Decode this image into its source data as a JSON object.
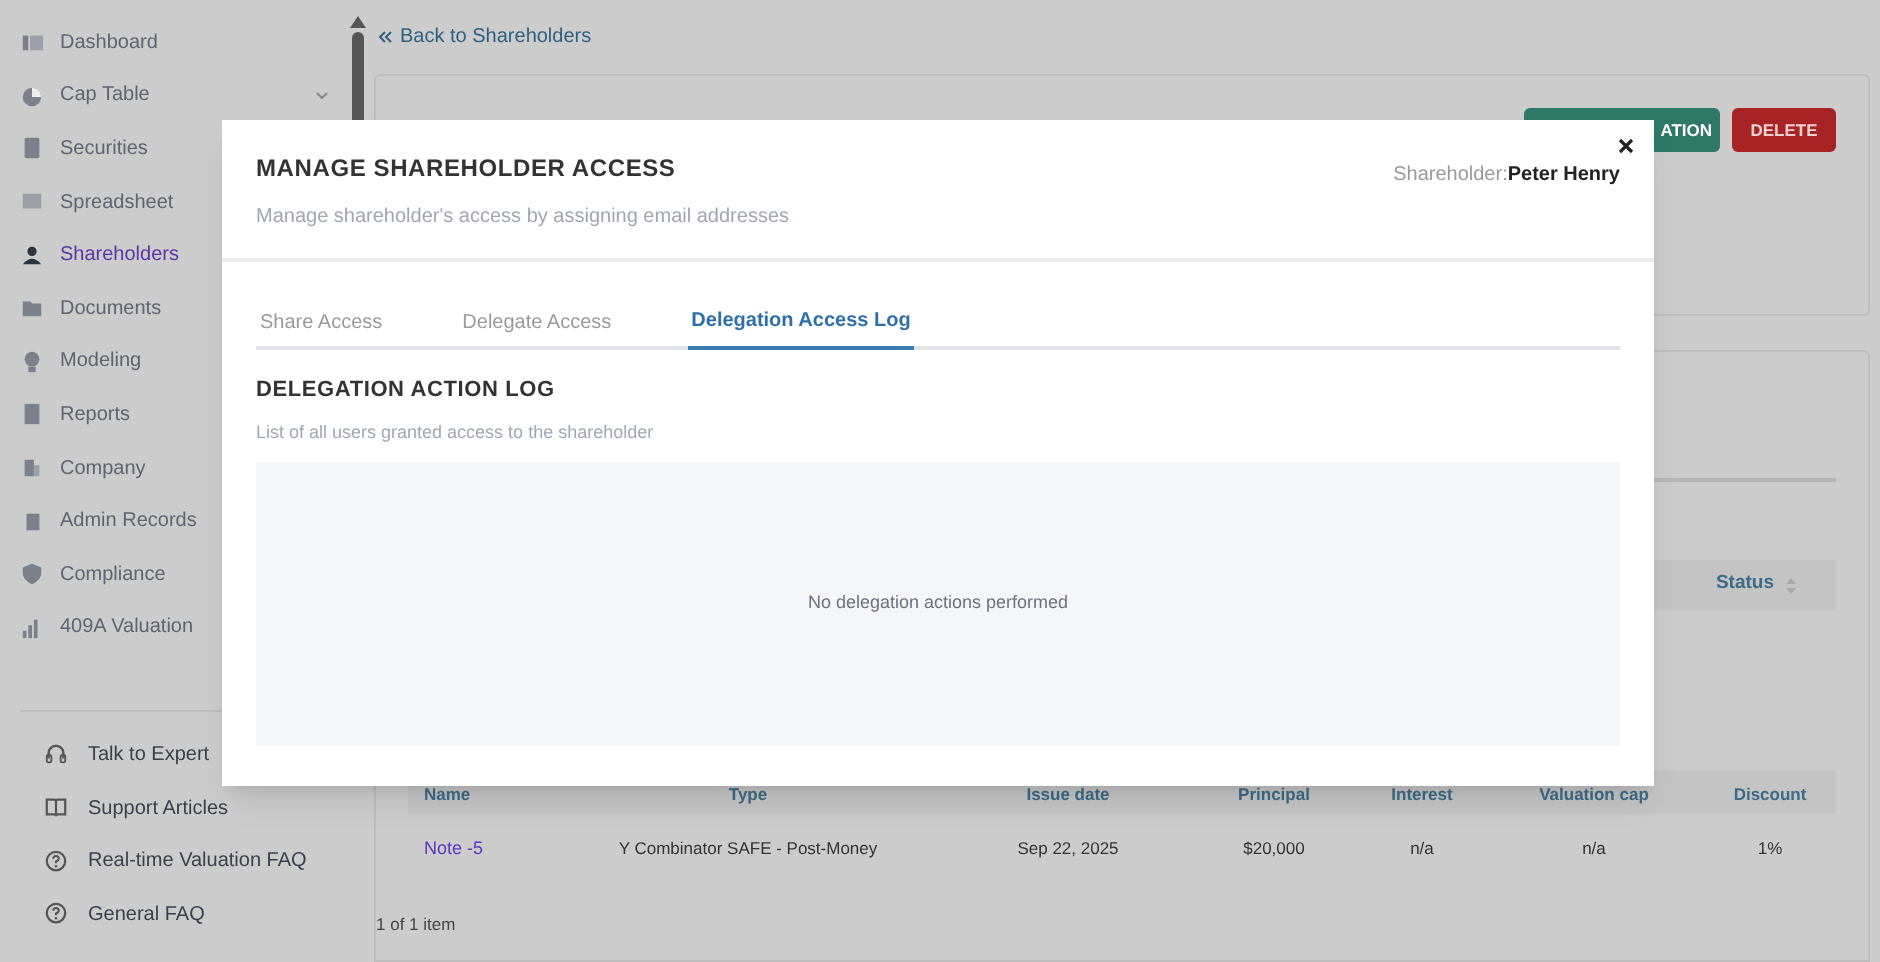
{
  "sidebar": {
    "items": [
      {
        "label": "Dashboard",
        "selected": false,
        "expandable": false
      },
      {
        "label": "Cap Table",
        "selected": false,
        "expandable": true
      },
      {
        "label": "Securities",
        "selected": false,
        "expandable": false
      },
      {
        "label": "Spreadsheet",
        "selected": false,
        "expandable": false
      },
      {
        "label": "Shareholders",
        "selected": true,
        "expandable": false
      },
      {
        "label": "Documents",
        "selected": false,
        "expandable": false
      },
      {
        "label": "Modeling",
        "selected": false,
        "expandable": false
      },
      {
        "label": "Reports",
        "selected": false,
        "expandable": false
      },
      {
        "label": "Company",
        "selected": false,
        "expandable": false
      },
      {
        "label": "Admin Records",
        "selected": false,
        "expandable": false
      },
      {
        "label": "Compliance",
        "selected": false,
        "expandable": false
      },
      {
        "label": "409A Valuation",
        "selected": false,
        "expandable": false
      }
    ],
    "help_links": [
      "Talk to Expert",
      "Support Articles",
      "Real-time Valuation FAQ",
      "General FAQ"
    ]
  },
  "back_link": "Back to Shareholders",
  "actions": [
    {
      "label": "ATION",
      "kind": "primary"
    },
    {
      "label": "DELETE",
      "kind": "danger"
    }
  ],
  "transactions_table": {
    "columns": [
      "Status"
    ]
  },
  "notes_table": {
    "columns": [
      "Name",
      "Type",
      "Issue date",
      "Principal",
      "Interest",
      "Valuation cap",
      "Discount"
    ],
    "rows": [
      [
        "Note -5",
        "Y Combinator SAFE - Post-Money",
        "Sep 22, 2025",
        "$20,000",
        "n/a",
        "n/a",
        "1%"
      ]
    ],
    "pagination": "1 of 1 item"
  },
  "modal": {
    "title": "MANAGE SHAREHOLDER ACCESS",
    "subtitle": "Manage shareholder's access by assigning email addresses",
    "shareholder_label": "Shareholder:",
    "shareholder_name": "Peter Henry",
    "tabs": [
      {
        "label": "Share Access",
        "selected": false
      },
      {
        "label": "Delegate Access",
        "selected": false
      },
      {
        "label": "Delegation Access Log",
        "selected": true
      }
    ],
    "section_title": "DELEGATION ACTION LOG",
    "section_subtitle": "List of all users granted access to the shareholder",
    "empty_message": "No delegation actions performed"
  }
}
